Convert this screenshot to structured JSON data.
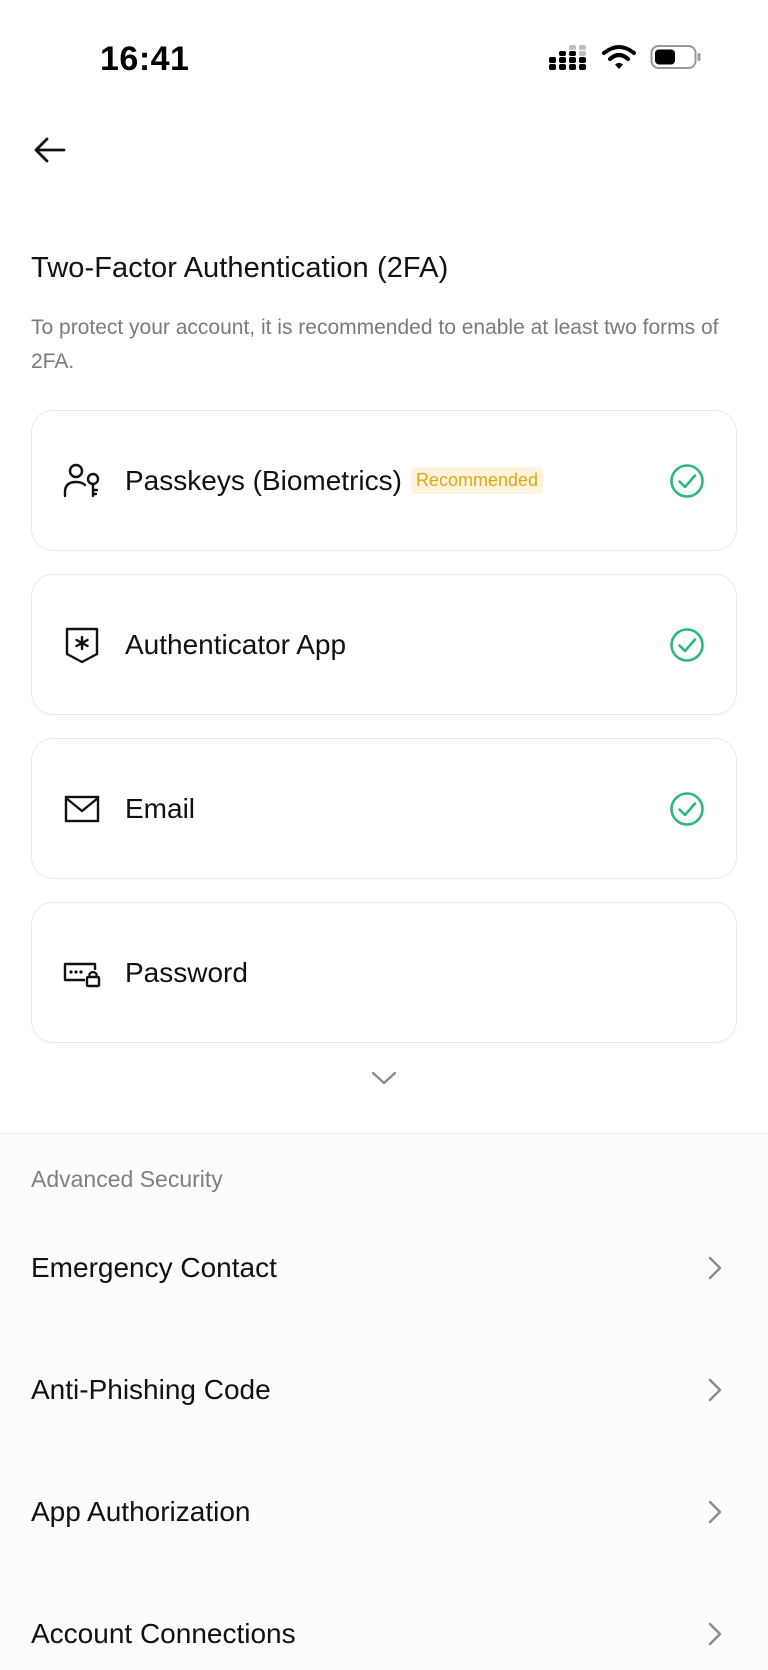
{
  "status_bar": {
    "time": "16:41",
    "icons": [
      "cellular-signal-icon",
      "wifi-icon",
      "battery-icon"
    ]
  },
  "nav": {
    "back_icon": "arrow-left-icon"
  },
  "two_fa": {
    "title": "Two-Factor Authentication (2FA)",
    "description": "To protect your account, it is recommended to enable at least two forms of 2FA.",
    "methods": [
      {
        "label": "Passkeys (Biometrics)",
        "badge": "Recommended",
        "icon": "passkey-user-icon",
        "enabled": true
      },
      {
        "label": "Authenticator App",
        "badge": "",
        "icon": "authenticator-shield-icon",
        "enabled": true
      },
      {
        "label": "Email",
        "badge": "",
        "icon": "envelope-icon",
        "enabled": true
      },
      {
        "label": "Password",
        "badge": "",
        "icon": "password-lock-icon",
        "enabled": false
      }
    ],
    "expand_icon": "chevron-down-icon"
  },
  "advanced": {
    "title": "Advanced Security",
    "items": [
      {
        "label": "Emergency Contact"
      },
      {
        "label": "Anti-Phishing Code"
      },
      {
        "label": "App Authorization"
      },
      {
        "label": "Account Connections"
      }
    ]
  },
  "colors": {
    "check_green": "#2fb584",
    "badge_text": "#e0a812",
    "badge_bg": "#fdf4dd",
    "muted_text": "#7b7b7b"
  }
}
